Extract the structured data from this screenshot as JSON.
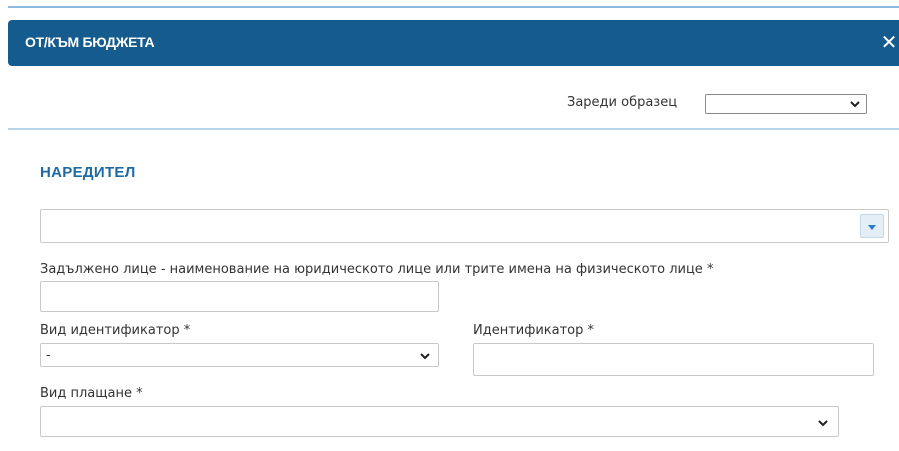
{
  "dialog": {
    "title": "ОТ/КЪМ БЮДЖЕТА",
    "close_icon": "close-icon"
  },
  "toolbar": {
    "template_label": "Зареди образец",
    "template_value": ""
  },
  "section": {
    "title": "НАРЕДИТЕЛ"
  },
  "form": {
    "payer_combo_value": "",
    "obligated_label": "Задължено лице - наименование на юридическото лице или трите имена на физическото лице *",
    "obligated_value": "",
    "id_type_label": "Вид идентификатор *",
    "id_type_value": "-",
    "identifier_label": "Идентификатор *",
    "identifier_value": "",
    "payment_type_label": "Вид плащане *",
    "payment_type_value": ""
  },
  "colors": {
    "header_bg": "#155b8d",
    "section_title": "#1d6aa5",
    "divider": "#b7d6ee"
  }
}
